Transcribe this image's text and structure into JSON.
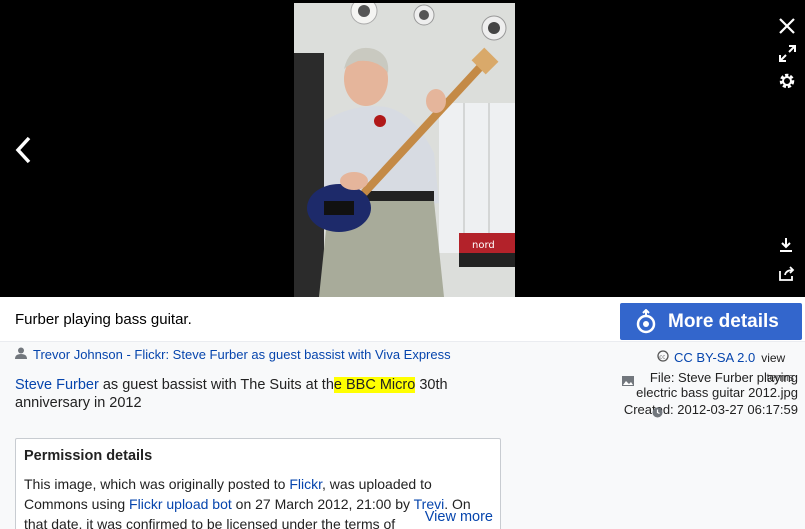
{
  "viewer": {
    "photo_alt": "Furber playing bass guitar.",
    "amp_brand": "nord"
  },
  "controls": {
    "close": "close-icon",
    "fullscreen": "fullscreen-icon",
    "settings": "gear-icon",
    "previous": "chevron-left-icon",
    "download": "download-icon",
    "share": "share-icon"
  },
  "caption": "Furber playing bass guitar.",
  "more_details": "More details",
  "author": {
    "user": "Trevor Johnson",
    "separator": " - ",
    "source": "Flickr: Steve Furber as guest bassist with Viva Express"
  },
  "description": {
    "link": "Steve Furber",
    "text_before_highlight": " as guest bassist with The Suits at th",
    "highlight": "e BBC Micro",
    "text_after": " 30th anniversary in 2012"
  },
  "license": {
    "name": "CC BY-SA 2.0",
    "view": "view"
  },
  "file": {
    "label": "File: Steve Furber playing electric bass guitar 2012.jpg",
    "terms": "terms"
  },
  "created": {
    "label": "Created: 2012-03-27 06:17:59"
  },
  "permission": {
    "title": "Permission details",
    "p1": "This image, which was originally posted to ",
    "flickr": "Flickr",
    "p2": ", was uploaded to Commons using ",
    "bot": "Flickr upload bot",
    "p3": " on 27 March 2012, 21:00 by ",
    "user": "Trevi",
    "p4": ". On that date, it was confirmed to be licensed under the terms of",
    "view_more": "View more"
  },
  "colors": {
    "accent": "#3366cc",
    "link": "#0645ad",
    "highlight": "#ffff00"
  }
}
